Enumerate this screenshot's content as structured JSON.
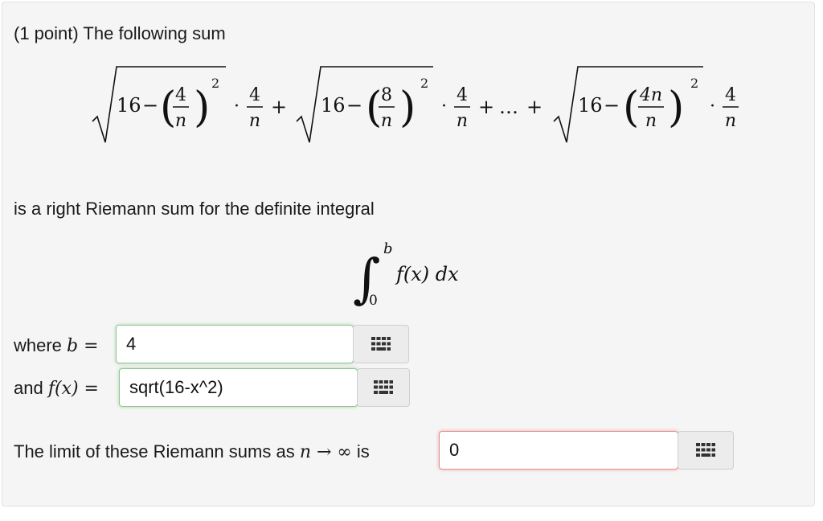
{
  "problem": {
    "header": "(1 point) The following sum",
    "riemann_text": "is a right Riemann sum for the definite integral",
    "where_label": "where",
    "and_label": "and",
    "limit_text_before": "The limit of these Riemann sums as",
    "limit_text_after": "is"
  },
  "formula": {
    "radicand_const": "16",
    "minus": "−",
    "exponent": "2",
    "term1_num": "4",
    "term2_num": "8",
    "term3_num": "4n",
    "den": "n",
    "factor_num": "4",
    "factor_den": "n",
    "dot": "·",
    "plus": "+",
    "ellipsis": "…"
  },
  "integral": {
    "lower": "0",
    "upper": "b",
    "integrand": "f(x) dx"
  },
  "math_labels": {
    "b_eq": "b =",
    "fx_eq": "f(x) =",
    "n_to_inf": "n → ∞"
  },
  "answers": {
    "b_value": "4",
    "f_value": "sqrt(16-x^2)",
    "limit_value": "0"
  },
  "icons": {
    "keypad": "keypad-icon"
  },
  "colors": {
    "correct_border": "#8fc58f",
    "incorrect_border": "#e58a8a",
    "card_background": "#f5f5f5"
  }
}
